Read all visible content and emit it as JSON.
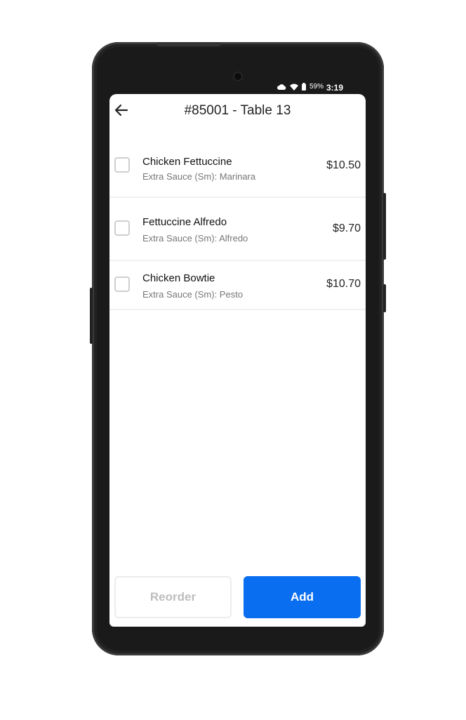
{
  "status_bar": {
    "battery": "59%",
    "time": "3:19",
    "icons": [
      "cloud-icon",
      "wifi-icon",
      "battery-icon"
    ]
  },
  "header": {
    "back_icon": "arrow-left-icon",
    "title": "#85001 - Table 13"
  },
  "items": [
    {
      "name": "Chicken Fettuccine",
      "modifier": "Extra Sauce (Sm): Marinara",
      "price": "$10.50",
      "checked": false
    },
    {
      "name": "Fettuccine Alfredo",
      "modifier": "Extra Sauce (Sm): Alfredo",
      "price": "$9.70",
      "checked": false
    },
    {
      "name": "Chicken Bowtie",
      "modifier": "Extra Sauce (Sm): Pesto",
      "price": "$10.70",
      "checked": false
    }
  ],
  "footer": {
    "reorder_label": "Reorder",
    "add_label": "Add"
  },
  "colors": {
    "accent": "#0a6ef0",
    "disabled_text": "#bdbdbd",
    "device_body": "#1a1a1a"
  }
}
